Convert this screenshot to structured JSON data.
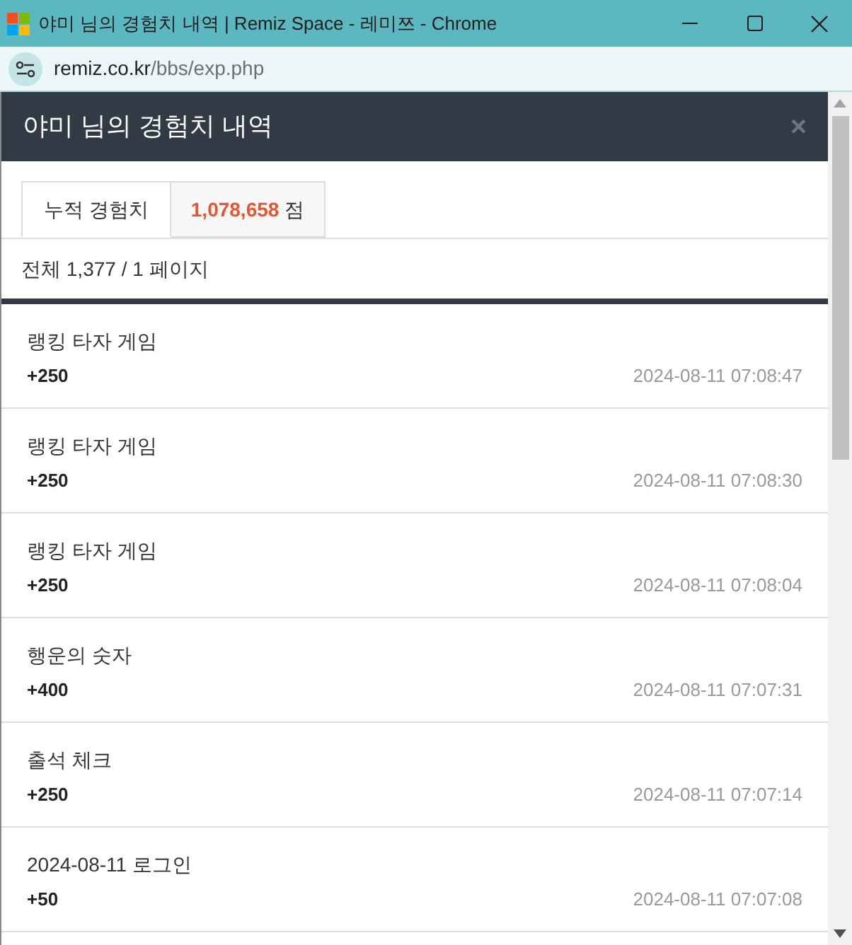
{
  "window": {
    "title": "야미 님의 경험치 내역 | Remiz Space - 레미쯔 - Chrome",
    "url_host": "remiz.co.kr",
    "url_path": "/bbs/exp.php"
  },
  "modal": {
    "title": "야미 님의 경험치 내역",
    "close": "×"
  },
  "tabs": [
    {
      "label": "누적 경험치",
      "selected": true
    },
    {
      "value": "1,078,658",
      "unit": "점",
      "selected": false
    }
  ],
  "summary": "전체 1,377 / 1 페이지",
  "entries": [
    {
      "title": "랭킹 타자 게임",
      "points": "+250",
      "time": "2024-08-11 07:08:47"
    },
    {
      "title": "랭킹 타자 게임",
      "points": "+250",
      "time": "2024-08-11 07:08:30"
    },
    {
      "title": "랭킹 타자 게임",
      "points": "+250",
      "time": "2024-08-11 07:08:04"
    },
    {
      "title": "행운의 숫자",
      "points": "+400",
      "time": "2024-08-11 07:07:31"
    },
    {
      "title": "출석 체크",
      "points": "+250",
      "time": "2024-08-11 07:07:14"
    },
    {
      "title": "2024-08-11 로그인",
      "points": "+50",
      "time": "2024-08-11 07:07:08"
    }
  ]
}
